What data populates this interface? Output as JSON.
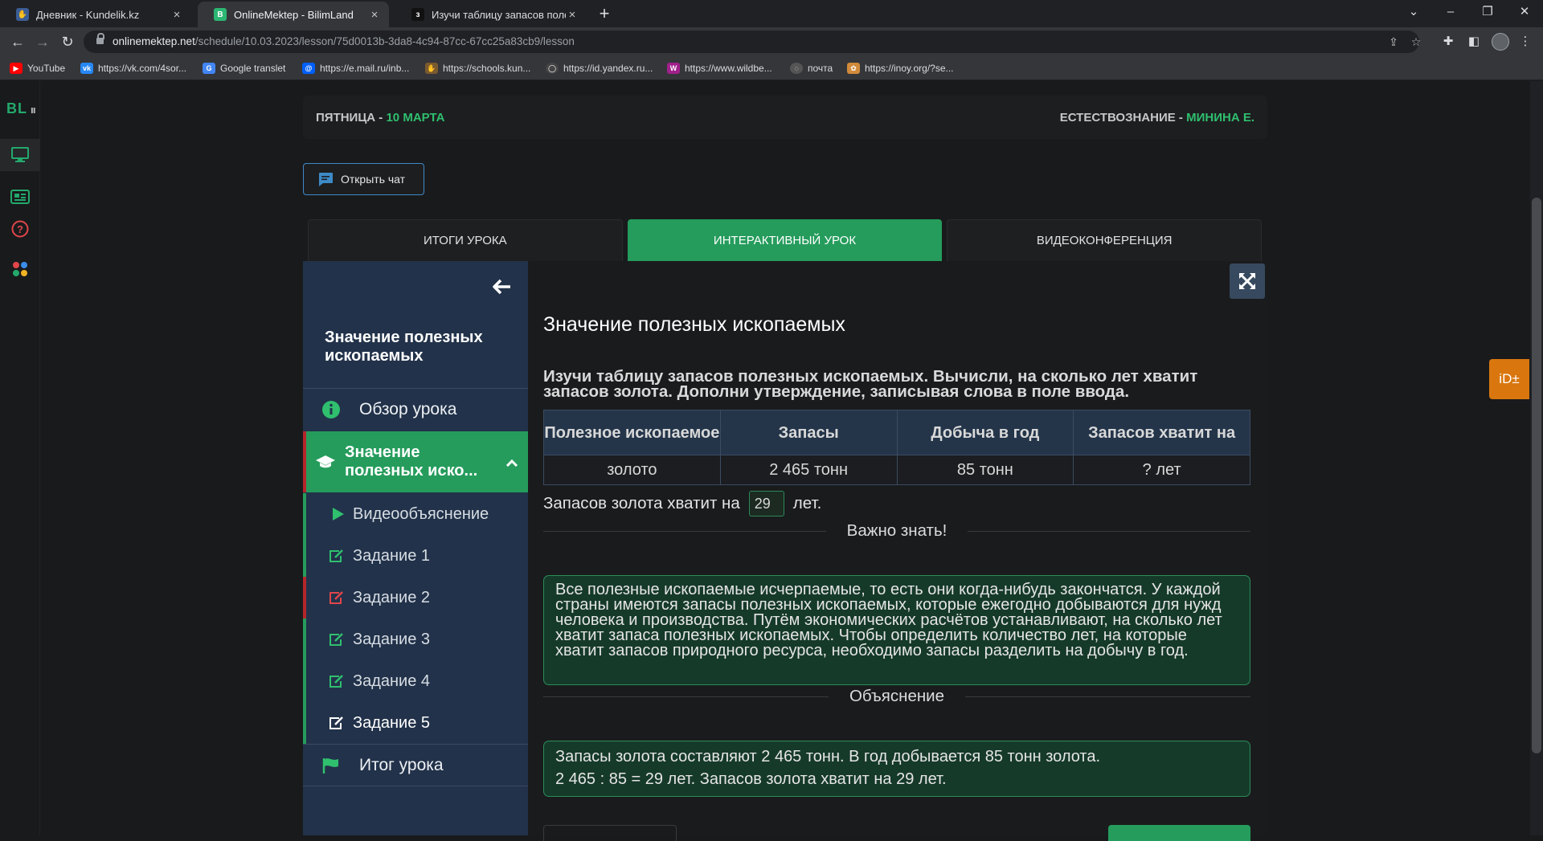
{
  "browser": {
    "tabs": [
      {
        "title": "Дневник - Kundelik.kz",
        "icon": "kundelik-icon"
      },
      {
        "title": "OnlineMektep - BilimLand",
        "icon": "bilimland-icon"
      },
      {
        "title": "Изучи таблицу запасов полезн",
        "icon": "tab-page-icon"
      }
    ],
    "url_host": "onlinemektep.net",
    "url_path": "/schedule/10.03.2023/lesson/75d0013b-3da8-4c94-87cc-67cc25a83cb9/lesson",
    "bookmarks": [
      {
        "label": "YouTube",
        "color": "#ff0000"
      },
      {
        "label": "https://vk.com/4sor...",
        "color": "#2787f5"
      },
      {
        "label": "Google translet",
        "color": "#4285f4"
      },
      {
        "label": "https://e.mail.ru/inb...",
        "color": "#005ff9"
      },
      {
        "label": "https://schools.kun...",
        "color": "#7a5a2f"
      },
      {
        "label": "https://id.yandex.ru...",
        "color": "#444444"
      },
      {
        "label": "https://www.wildbe...",
        "color": "#a0208c"
      },
      {
        "label": "почта",
        "color": "#555555"
      },
      {
        "label": "https://inoy.org/?se...",
        "color": "#d08a3a"
      }
    ]
  },
  "header": {
    "day": "ПЯТНИЦА - ",
    "date": "10 МАРТА",
    "subject": "ЕСТЕСТВОЗНАНИЕ - ",
    "teacher": "МИНИНА Е."
  },
  "chat_button": "Открыть чат",
  "page_tabs": [
    "ИТОГИ УРОКА",
    "ИНТЕРАКТИВНЫЙ УРОК",
    "ВИДЕОКОНФЕРЕНЦИЯ"
  ],
  "sidebar": {
    "title": "Значение полезных ископаемых",
    "overview": "Обзор урока",
    "active_section": "Значение полезных иско...",
    "items": [
      "Видеообъяснение",
      "Задание 1",
      "Задание 2",
      "Задание 3",
      "Задание 4",
      "Задание 5"
    ],
    "summary": "Итог урока"
  },
  "lesson": {
    "title": "Значение полезных ископаемых",
    "instruction": "Изучи таблицу запасов полезных ископаемых. Вычисли, на сколько лет хватит запасов золота. Дополни утверждение, записывая слова в поле ввода.",
    "table": {
      "headers": [
        "Полезное ископаемое",
        "Запасы",
        "Добыча в год",
        "Запасов хватит на"
      ],
      "row": [
        "золото",
        "2 465 тонн",
        "85 тонн",
        "? лет"
      ]
    },
    "answer_prefix": "Запасов золота хватит на",
    "answer_value": "29",
    "answer_suffix": "лет.",
    "important_heading": "Важно знать!",
    "important_text": "Все полезные ископаемые исчерпаемые, то есть они когда-нибудь закончатся. У каждой страны имеются запасы полезных ископаемых, которые ежегодно добываются для нужд человека и производства. Путём экономических расчётов устанавливают, на сколько лет хватит запаса полезных ископаемых. Чтобы определить количество лет, на которые хватит запасов природного ресурса, необходимо запасы разделить на добычу в год.",
    "explanation_heading": "Объяснение",
    "explanation_line1": "Запасы золота составляют 2 465 тонн. В год добывается 85 тонн золота.",
    "explanation_line2": "2 465 : 85 = 29 лет. Запасов золота хватит на 29 лет."
  },
  "side_widget": "iD±",
  "colors": {
    "accent_green": "#259c5c",
    "sidebar_bg": "#22324a",
    "error_red": "#b5262b"
  }
}
